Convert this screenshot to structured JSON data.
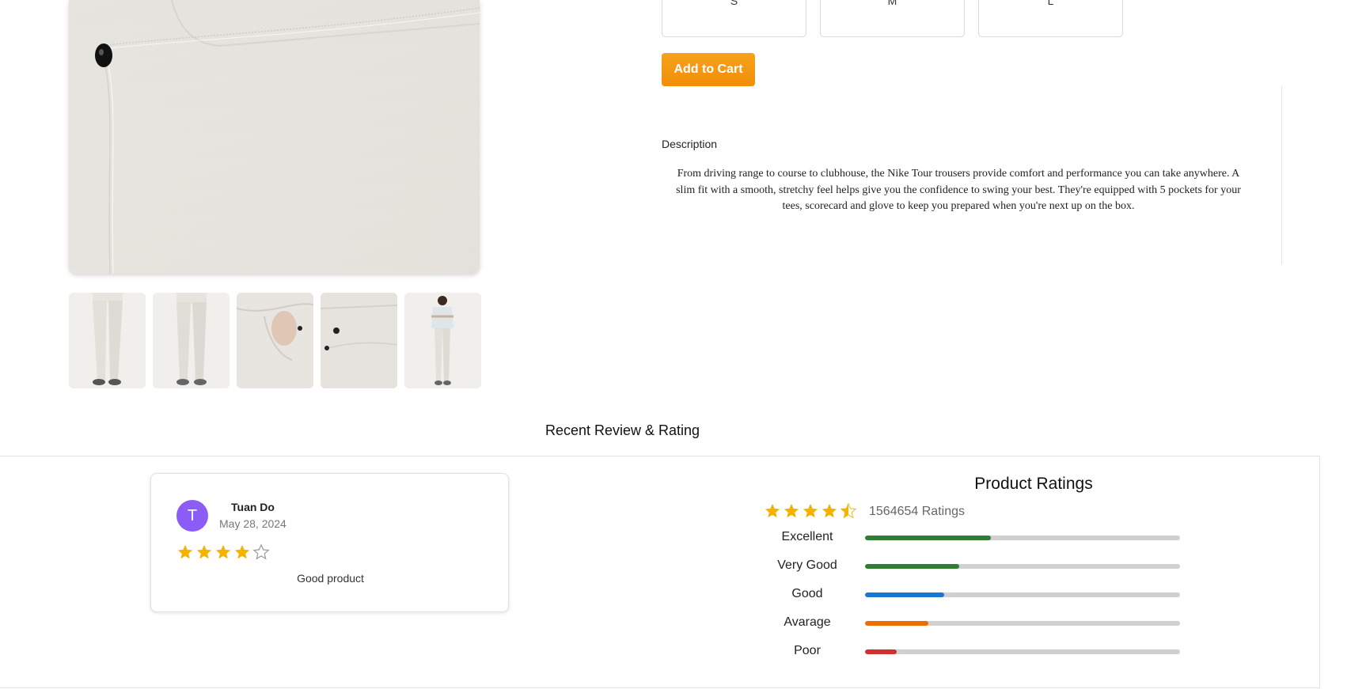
{
  "product": {
    "sizes": [
      "S",
      "M",
      "L"
    ],
    "add_to_cart_label": "Add to Cart",
    "description_title": "Description",
    "description_text": "From driving range to course to clubhouse, the Nike Tour trousers provide comfort and performance you can take anywhere. A slim fit with a smooth, stretchy feel helps give you the confidence to swing your best. They're equipped with 5 pockets for your tees, scorecard and glove to keep you prepared when you're next up on the box."
  },
  "reviews": {
    "section_title": "Recent Review & Rating",
    "items": [
      {
        "avatar_initial": "T",
        "name": "Tuan Do",
        "date": "May 28, 2024",
        "rating": 4,
        "text": "Good product"
      }
    ]
  },
  "ratings": {
    "title": "Product Ratings",
    "average": 4.5,
    "count_text": "1564654 Ratings",
    "breakdown": [
      {
        "label": "Excellent",
        "fraction": 0.4,
        "color": "#2e7d32"
      },
      {
        "label": "Very Good",
        "fraction": 0.3,
        "color": "#2e7d32"
      },
      {
        "label": "Good",
        "fraction": 0.25,
        "color": "#1976d2"
      },
      {
        "label": "Avarage",
        "fraction": 0.2,
        "color": "#ef6c00"
      },
      {
        "label": "Poor",
        "fraction": 0.1,
        "color": "#d32f2f"
      }
    ]
  },
  "colors": {
    "accent": "#f39411",
    "star": "#f5b301",
    "avatar": "#8b5cf6"
  }
}
